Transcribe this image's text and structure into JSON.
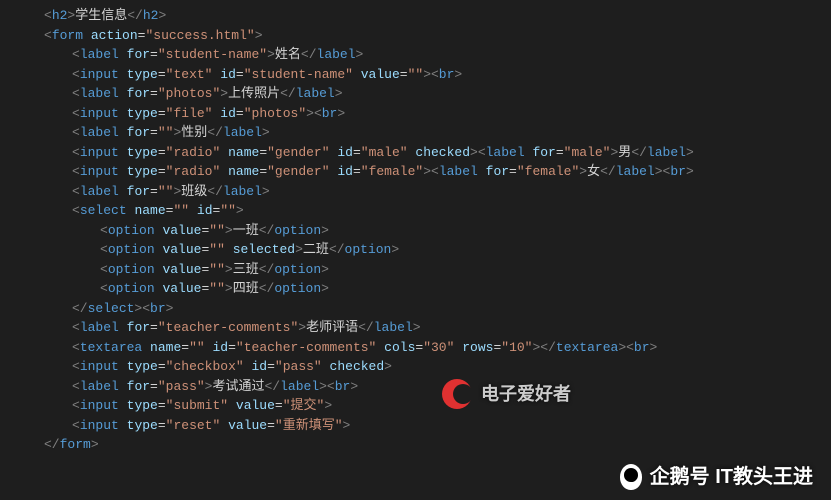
{
  "code": {
    "h2_text": "学生信息",
    "form_action": "\"success.html\"",
    "student_name": {
      "for": "\"student-name\"",
      "label_text": "姓名",
      "input_type": "\"text\"",
      "input_id": "\"student-name\"",
      "input_value": "\"\""
    },
    "photos": {
      "for": "\"photos\"",
      "label_text": "上传照片",
      "input_type": "\"file\"",
      "input_id": "\"photos\""
    },
    "gender": {
      "for": "\"\"",
      "label_text": "性别",
      "male": {
        "type": "\"radio\"",
        "name": "\"gender\"",
        "id": "\"male\"",
        "checked": "checked",
        "label_for": "\"male\"",
        "label_text": "男"
      },
      "female": {
        "type": "\"radio\"",
        "name": "\"gender\"",
        "id": "\"female\"",
        "label_for": "\"female\"",
        "label_text": "女"
      }
    },
    "class": {
      "for": "\"\"",
      "label_text": "班级",
      "select_name": "\"\"",
      "select_id": "\"\"",
      "options": [
        {
          "value": "\"\"",
          "text": "一班",
          "selected": ""
        },
        {
          "value": "\"\"",
          "text": "二班",
          "selected": "selected"
        },
        {
          "value": "\"\"",
          "text": "三班",
          "selected": ""
        },
        {
          "value": "\"\"",
          "text": "四班",
          "selected": ""
        }
      ]
    },
    "teacher_comments": {
      "for": "\"teacher-comments\"",
      "label_text": "老师评语",
      "id": "\"teacher-comments\"",
      "name": "\"\"",
      "cols": "\"30\"",
      "rows": "\"10\""
    },
    "pass": {
      "type": "\"checkbox\"",
      "id": "\"pass\"",
      "checked": "checked",
      "label_for": "\"pass\"",
      "label_text": "考试通过"
    },
    "submit": {
      "type": "\"submit\"",
      "value": "\"提交\""
    },
    "reset": {
      "type": "\"reset\"",
      "value": "\"重新填写\""
    }
  },
  "watermark1_text": "电子爱好者",
  "watermark2_text": "企鹅号 IT教头王进"
}
